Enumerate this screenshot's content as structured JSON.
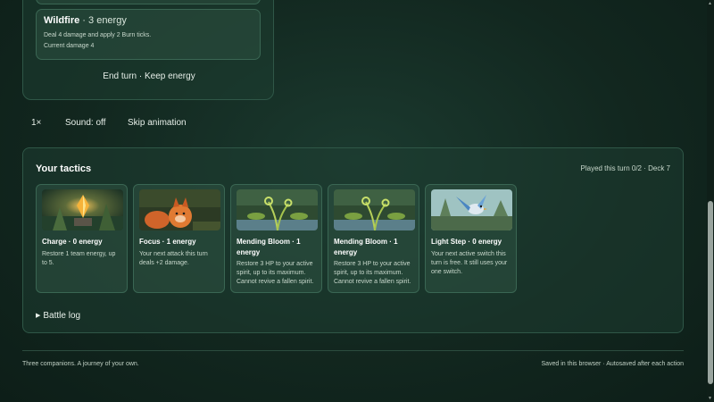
{
  "battle_panel": {
    "move": {
      "name": "Wildfire",
      "cost": " · 3 energy",
      "description": "Deal 4 damage and apply 2 Burn ticks.",
      "current_damage": "Current damage 4"
    },
    "end_turn_label": "End turn · Keep energy"
  },
  "controls": {
    "speed": "1×",
    "sound": "Sound: off",
    "skip": "Skip animation"
  },
  "tactics": {
    "title": "Your tactics",
    "meta": "Played this turn 0/2 · Deck 7",
    "cards": [
      {
        "title": "Charge · 0 energy",
        "description": "Restore 1 team energy, up to 5.",
        "art": "crystal-art"
      },
      {
        "title": "Focus · 1 energy",
        "description": "Your next attack this turn deals +2 damage.",
        "art": "fox-art"
      },
      {
        "title": "Mending Bloom · 1 energy",
        "description": "Restore 3 HP to your active spirit, up to its maximum. Cannot revive a fallen spirit.",
        "art": "fern-art"
      },
      {
        "title": "Mending Bloom · 1 energy",
        "description": "Restore 3 HP to your active spirit, up to its maximum. Cannot revive a fallen spirit.",
        "art": "fern-art"
      },
      {
        "title": "Light Step · 0 energy",
        "description": "Your next active switch this turn is free. It still uses your one switch.",
        "art": "bird-art"
      }
    ],
    "battle_log_label": "Battle log"
  },
  "footer": {
    "left": "Three companions. A journey of your own.",
    "right": "Saved in this browser · Autosaved after each action"
  },
  "colors": {
    "background": "#12271f",
    "panel": "#1e3e32",
    "border": "#3a6653",
    "text": "#e6efe7"
  }
}
